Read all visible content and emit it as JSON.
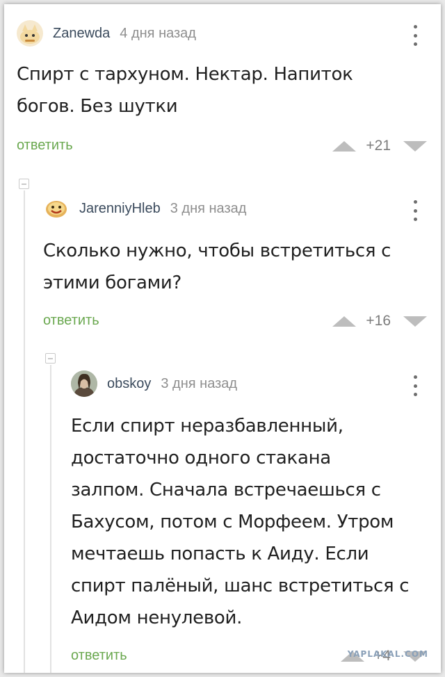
{
  "comments": [
    {
      "username": "Zanewda",
      "time": "4 дня назад",
      "text_lines": [
        "Спирт с тархуном. Нектар. Напиток",
        "богов. Без шутки"
      ],
      "reply_label": "ответить",
      "score": "+21",
      "avatar_icon": "cartoon-cat-avatar"
    },
    {
      "username": "JarenniyHleb",
      "time": "3 дня назад",
      "text_lines": [
        "Сколько нужно, чтобы встретиться с",
        "этими богами?"
      ],
      "reply_label": "ответить",
      "score": "+16",
      "avatar_icon": "smiley-bread-avatar"
    },
    {
      "username": "obskoy",
      "time": "3 дня назад",
      "text_lines": [
        "Если спирт неразбавленный,",
        "достаточно одного стакана",
        "залпом. Сначала встречаешься с",
        "Бахусом, потом с Морфеем. Утром",
        "мечтаешь попасть к Аиду. Если",
        "спирт палёный, шанс встретиться с",
        "Аидом ненулевой."
      ],
      "reply_label": "ответить",
      "score": "+4",
      "avatar_icon": "woman-photo-avatar"
    }
  ],
  "watermark": "YAPLAKAL.COM",
  "colors": {
    "reply_green": "#6aa84f",
    "vote_gray": "#bdbdbd",
    "username": "#3a4a5c",
    "text": "#202020"
  }
}
